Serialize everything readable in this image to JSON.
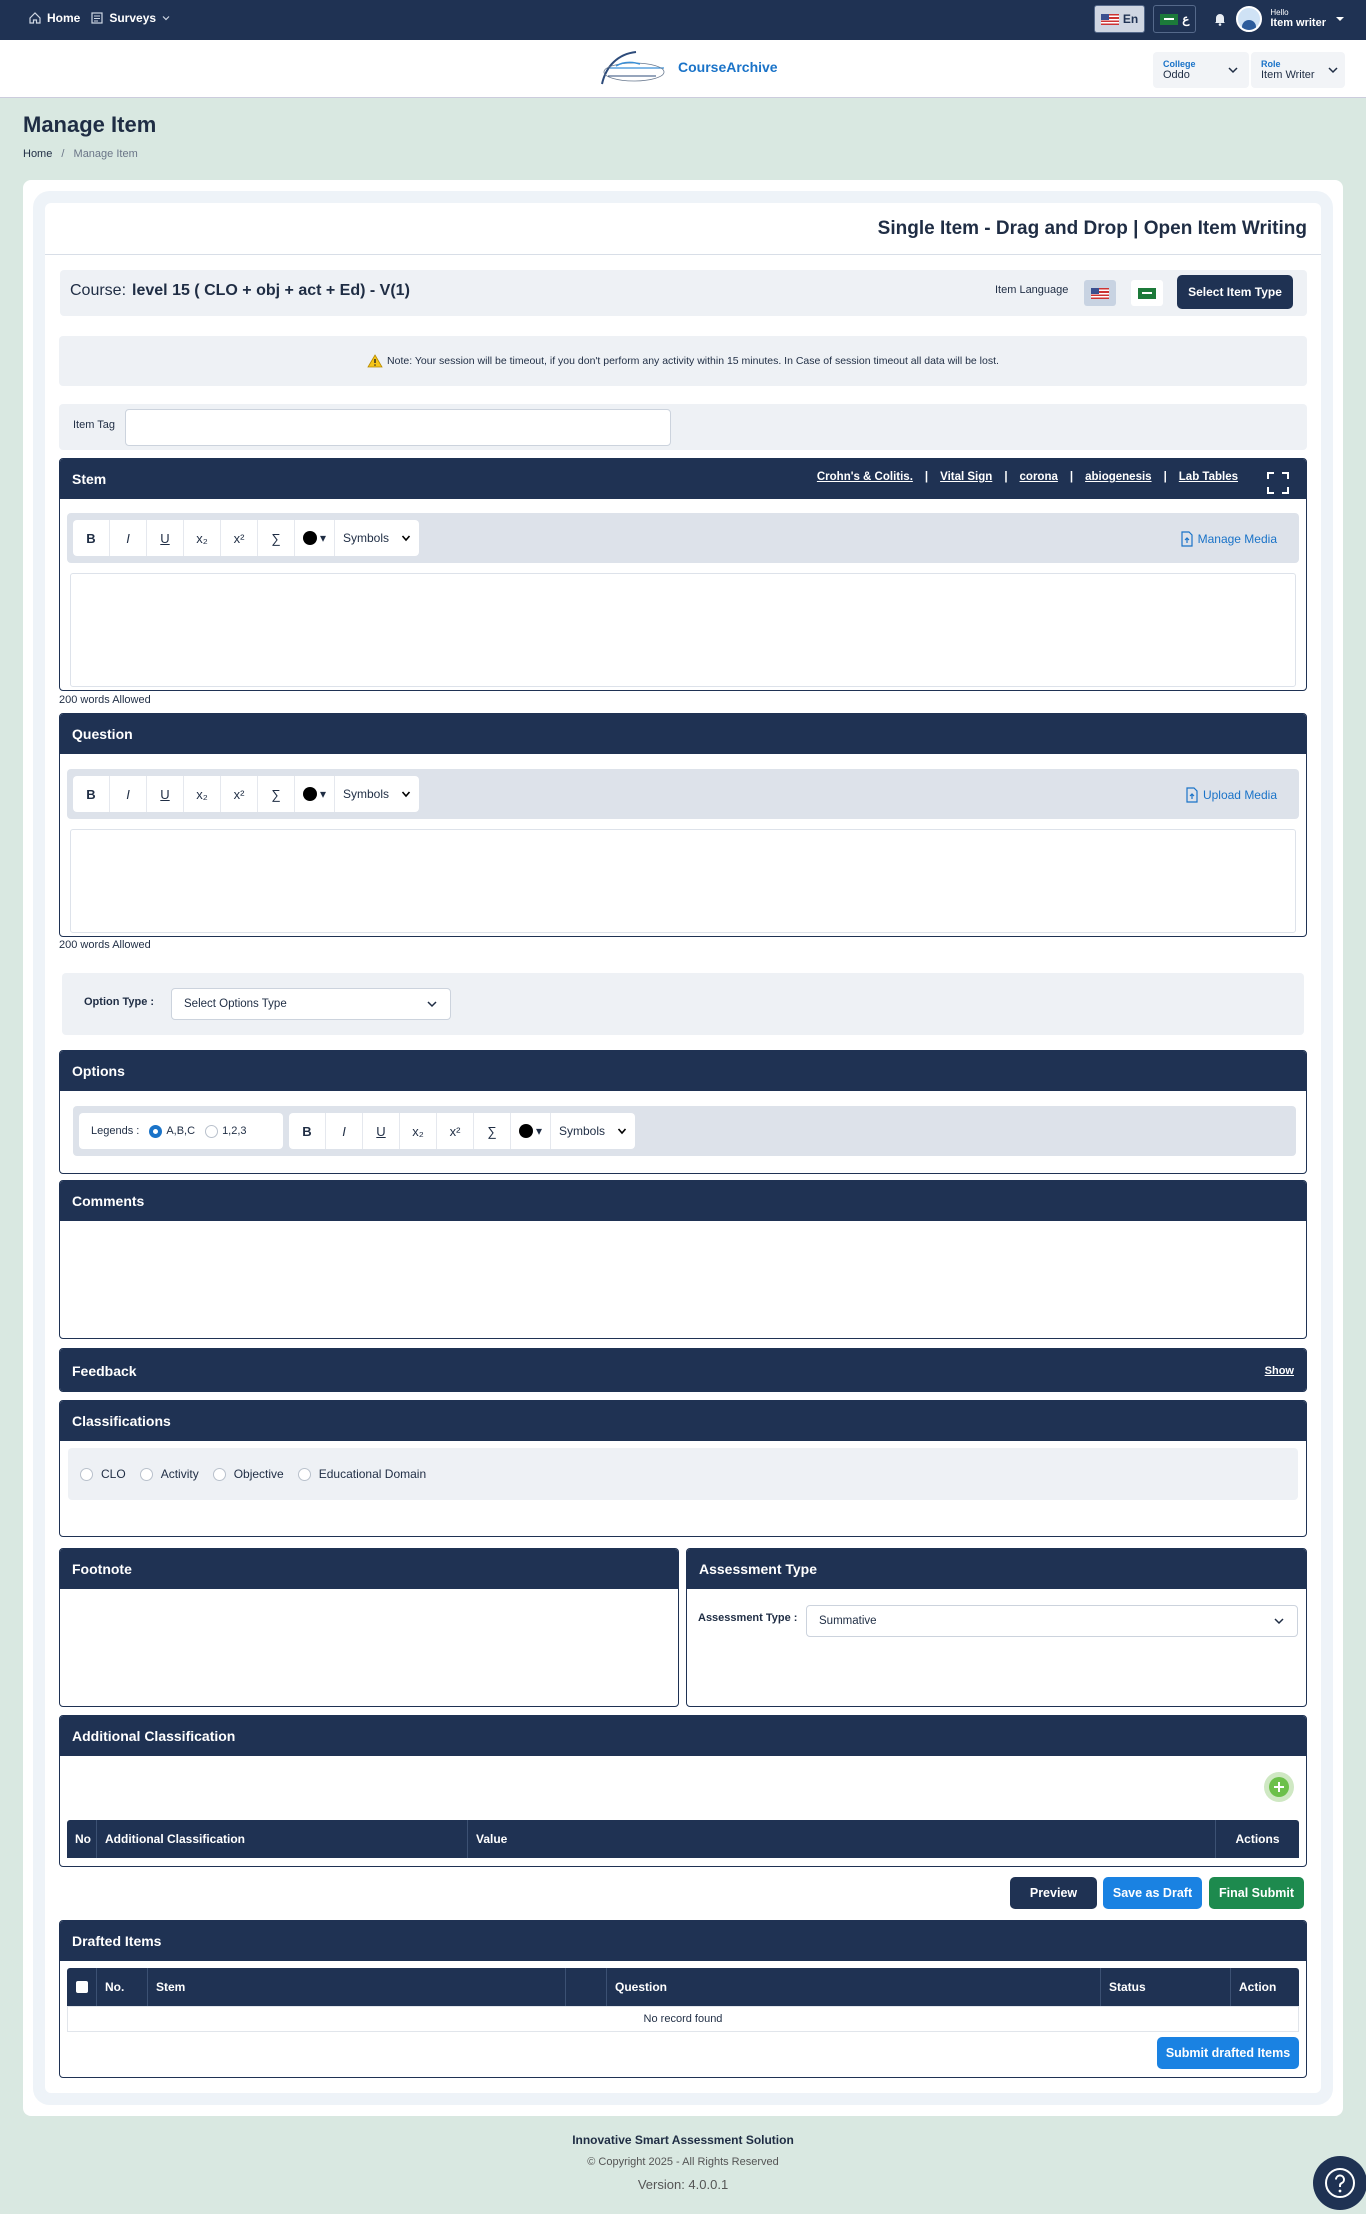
{
  "topbar": {
    "home_label": "Home",
    "surveys_label": "Surveys",
    "lang_en": "En",
    "lang_ar": "ع",
    "hello_small": "Hello",
    "user_role": "Item writer"
  },
  "brand": {
    "name": "CourseArchive"
  },
  "selectors": {
    "college_label": "College",
    "college_value": "Oddo",
    "role_label": "Role",
    "role_value": "Item Writer"
  },
  "page": {
    "title": "Manage Item",
    "breadcrumb_home": "Home",
    "breadcrumb_sep": "/",
    "breadcrumb_current": "Manage Item"
  },
  "card": {
    "title": "Single Item - Drag and Drop | Open Item Writing",
    "course_prefix": "Course:",
    "course_value": "level 15 ( CLO + obj + act + Ed) - V(1)",
    "item_language_label": "Item Language",
    "select_item_type": "Select Item Type",
    "note": "Note: Your session will be timeout, if you don't perform any activity within 15 minutes. In Case of session timeout all data will be lost.",
    "item_tag_label": "Item Tag",
    "item_tag_value": ""
  },
  "stem": {
    "title": "Stem",
    "links": [
      "Crohn's & Colitis.",
      "Vital Sign",
      "corona",
      "abiogenesis",
      "Lab Tables"
    ],
    "link_sep": "|",
    "manage_media": "Manage Media",
    "words_allowed": "200 words Allowed"
  },
  "toolbar": {
    "bold": "B",
    "italic": "I",
    "underline": "U",
    "subscript": "x₂",
    "superscript": "x²",
    "sigma": "∑",
    "color_caret": "▾",
    "symbols": "Symbols"
  },
  "question": {
    "title": "Question",
    "upload_media": "Upload Media",
    "words_allowed": "200 words Allowed"
  },
  "option_type": {
    "label": "Option Type :",
    "value": "Select Options Type"
  },
  "options": {
    "title": "Options",
    "legends_label": "Legends :",
    "legend_abc": "A,B,C",
    "legend_123": "1,2,3",
    "selected": "A,B,C"
  },
  "comments": {
    "title": "Comments"
  },
  "feedback": {
    "title": "Feedback",
    "show": "Show"
  },
  "classifications": {
    "title": "Classifications",
    "items": [
      "CLO",
      "Activity",
      "Objective",
      "Educational Domain"
    ]
  },
  "footnote": {
    "title": "Footnote"
  },
  "assessment": {
    "title": "Assessment Type",
    "label": "Assessment Type :",
    "value": "Summative"
  },
  "additional": {
    "title": "Additional Classification",
    "columns": [
      "No",
      "Additional Classification",
      "Value",
      "Actions"
    ]
  },
  "actions": {
    "preview": "Preview",
    "save_draft": "Save as Draft",
    "final_submit": "Final Submit"
  },
  "drafted": {
    "title": "Drafted Items",
    "columns": [
      "No.",
      "Stem",
      "",
      "Question",
      "Status",
      "Action"
    ],
    "empty": "No record found",
    "submit": "Submit drafted Items"
  },
  "footer": {
    "company": "Innovative Smart Assessment Solution",
    "copyright": "© Copyright 2025 - All Rights Reserved",
    "version": "Version: 4.0.0.1"
  },
  "colors": {
    "navy": "#1f3253",
    "blue": "#1a73c8",
    "save_blue": "#1a82e2",
    "green": "#1d8a4e",
    "add_green": "#6cc04a",
    "bg": "#d9e8e1"
  }
}
